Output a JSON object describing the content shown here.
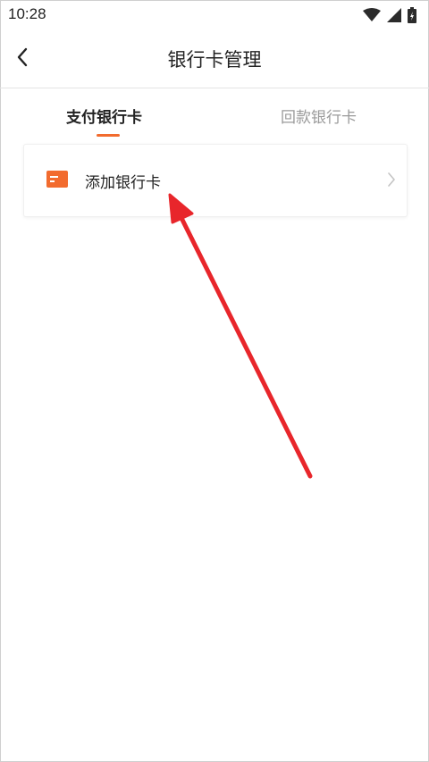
{
  "status_bar": {
    "time": "10:28",
    "icons": [
      "wifi-icon",
      "signal-icon",
      "battery-icon"
    ]
  },
  "header": {
    "title": "银行卡管理",
    "back_icon": "chevron-left-icon"
  },
  "tabs": [
    {
      "label": "支付银行卡",
      "active": true
    },
    {
      "label": "回款银行卡",
      "active": false
    }
  ],
  "card_list": {
    "items": [
      {
        "label": "添加银行卡",
        "icon": "bank-card-icon",
        "trailing_icon": "chevron-right-icon"
      }
    ]
  },
  "colors": {
    "accent": "#f26b2e",
    "annotation_arrow": "#e8262b",
    "inactive_tab": "#9a9a9a"
  }
}
